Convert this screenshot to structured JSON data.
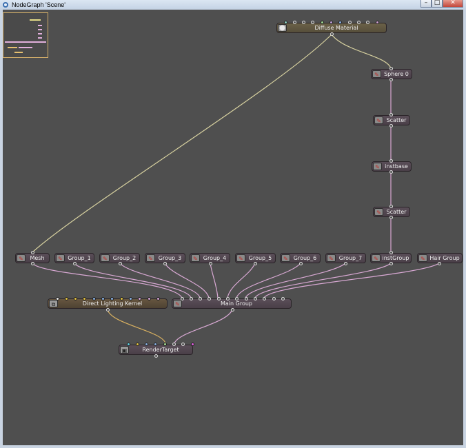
{
  "window": {
    "title": "NodeGraph 'Scene'"
  },
  "titlebar_buttons": {
    "minimize": "–",
    "maximize": "□",
    "close": "✕"
  },
  "nodes": {
    "diffuse_material": "Diffuse Material",
    "sphere0": "Sphere 0",
    "scatter1": "Scatter",
    "instbase": "instbase",
    "scatter2": "Scatter",
    "mesh": "Mesh",
    "group_1": "Group_1",
    "group_2": "Group_2",
    "group_3": "Group_3",
    "group_4": "Group_4",
    "group_5": "Group_5",
    "group_6": "Group_6",
    "group_7": "Group_7",
    "instgroup": "instGroup",
    "hair_group": "Hair Group",
    "direct_lighting_kernel": "Direct Lighting Kernel",
    "main_group": "Main Group",
    "render_target": "RenderTarget"
  },
  "colors": {
    "canvas": "#4f4f4f",
    "wire_material": "#d8d2a0",
    "wire_geometry": "#d9a9d4",
    "wire_kernel": "#d8b060",
    "node_geometry": "#574b55",
    "node_material": "#655b44"
  },
  "icons": {
    "geometry": "geometry-node-icon",
    "material": "material-sphere-icon",
    "kernel": "kernel-node-icon",
    "render": "render-target-icon"
  }
}
